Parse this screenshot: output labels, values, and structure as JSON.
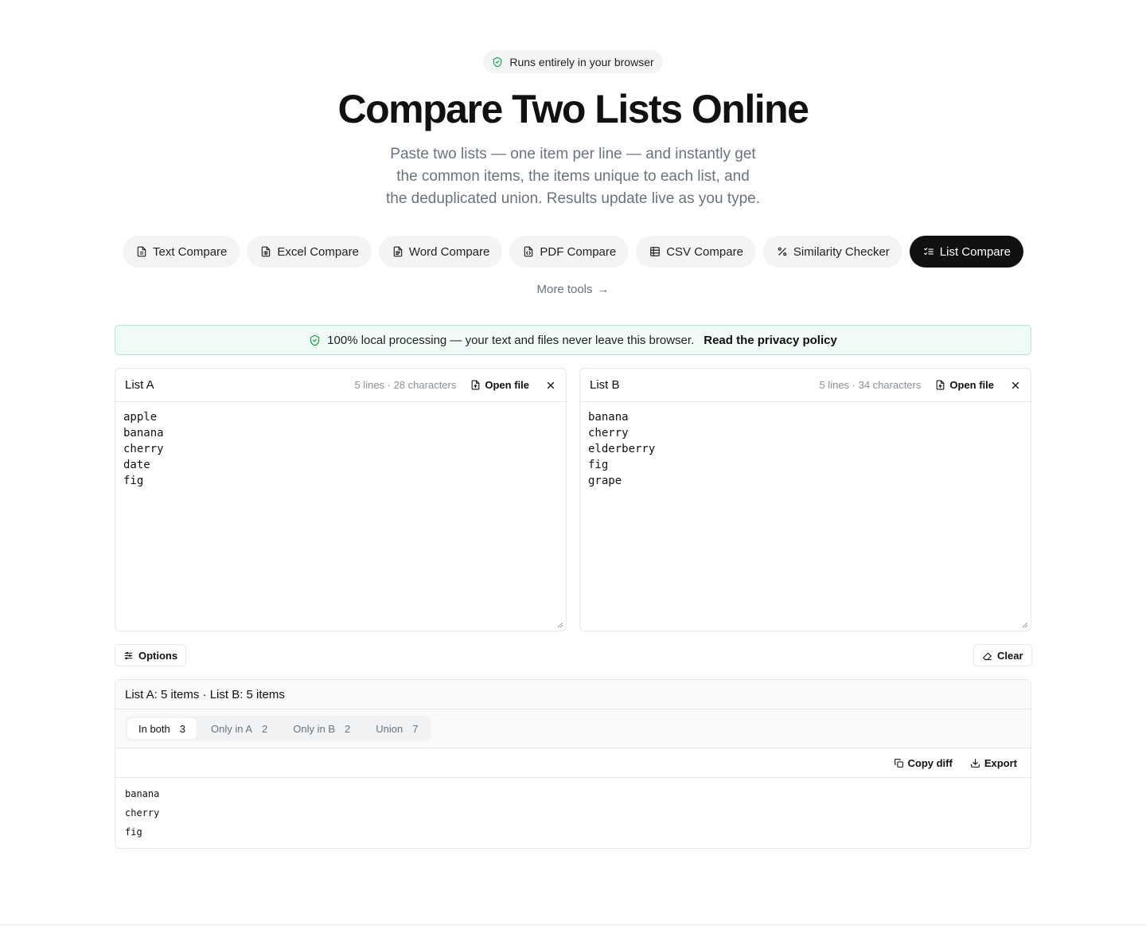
{
  "badge": {
    "text": "Runs entirely in your browser",
    "icon": "shield-check-icon"
  },
  "hero": {
    "title": "Compare Two Lists Online",
    "subtitle_lines": [
      "Paste two lists — one item per line — and instantly get",
      "the common items, the items unique to each list, and",
      "the deduplicated union. Results update live as you type."
    ]
  },
  "tools": [
    {
      "label": "Text Compare",
      "icon": "file-text-icon",
      "active": false
    },
    {
      "label": "Excel Compare",
      "icon": "file-spreadsheet-icon",
      "active": false
    },
    {
      "label": "Word Compare",
      "icon": "file-doc-icon",
      "active": false
    },
    {
      "label": "PDF Compare",
      "icon": "file-diff-icon",
      "active": false
    },
    {
      "label": "CSV Compare",
      "icon": "table-icon",
      "active": false
    },
    {
      "label": "Similarity Checker",
      "icon": "percent-icon",
      "active": false
    },
    {
      "label": "List Compare",
      "icon": "list-checks-icon",
      "active": true
    }
  ],
  "more_tools": {
    "label": "More tools"
  },
  "privacy": {
    "text": "100% local processing — your text and files never leave this browser.",
    "link": "Read the privacy policy"
  },
  "list_a": {
    "title": "List A",
    "meta": "5 lines · 28 characters",
    "open_file": "Open file",
    "content": "apple\nbanana\ncherry\ndate\nfig"
  },
  "list_b": {
    "title": "List B",
    "meta": "5 lines · 34 characters",
    "open_file": "Open file",
    "content": "banana\ncherry\nelderberry\nfig\ngrape"
  },
  "controls": {
    "options": "Options",
    "clear": "Clear"
  },
  "results": {
    "summary": "List A: 5 items · List B: 5 items",
    "tabs": [
      {
        "label": "In both",
        "count": "3",
        "active": true
      },
      {
        "label": "Only in A",
        "count": "2",
        "active": false
      },
      {
        "label": "Only in B",
        "count": "2",
        "active": false
      },
      {
        "label": "Union",
        "count": "7",
        "active": false
      }
    ],
    "actions": {
      "copy_diff": "Copy diff",
      "export": "Export"
    },
    "items": [
      "banana",
      "cherry",
      "fig"
    ]
  },
  "colors": {
    "accent_green": "#16a34a",
    "active_dark": "#111111",
    "muted_text": "#6b7280"
  }
}
